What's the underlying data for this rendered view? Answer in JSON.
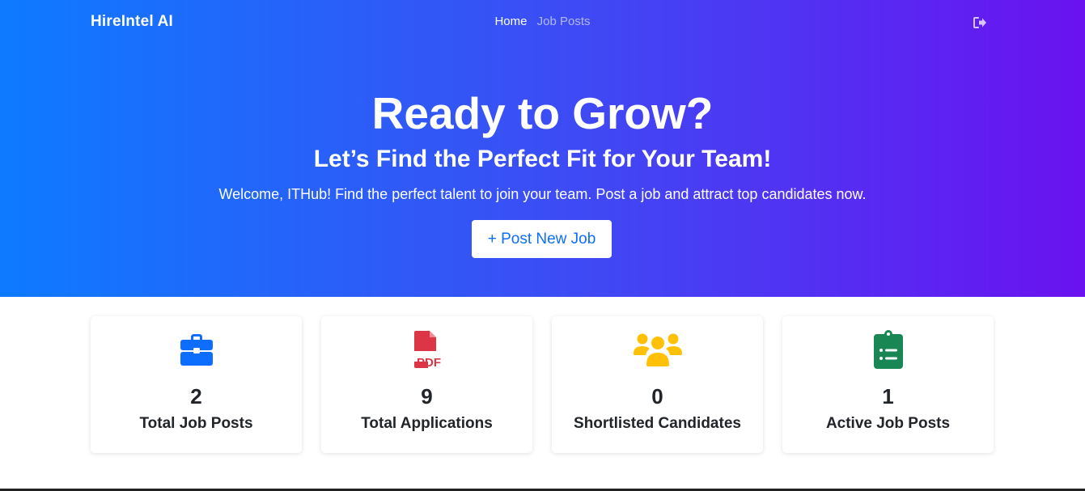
{
  "navbar": {
    "brand": "HireIntel AI",
    "links": [
      {
        "label": "Home"
      },
      {
        "label": "Job Posts"
      }
    ],
    "logout_icon": "sign-out-icon"
  },
  "hero": {
    "title": "Ready to Grow?",
    "subtitle": "Let’s Find the Perfect Fit for Your Team!",
    "welcome": "Welcome, ITHub! Find the perfect talent to join your team. Post a job and attract top candidates now.",
    "post_button": "+ Post New Job"
  },
  "stats": [
    {
      "value": "2",
      "label": "Total Job Posts",
      "icon": "briefcase-icon",
      "color": "#0d6efd"
    },
    {
      "value": "9",
      "label": "Total Applications",
      "icon": "pdf-file-icon",
      "color": "#dc3545"
    },
    {
      "value": "0",
      "label": "Shortlisted Candidates",
      "icon": "people-icon",
      "color": "#ffc107"
    },
    {
      "value": "1",
      "label": "Active Job Posts",
      "icon": "clipboard-list-icon",
      "color": "#198754"
    }
  ],
  "colors": {
    "gradient_start": "#0d7bff",
    "gradient_end": "#6a12f0",
    "primary": "#0d6efd"
  }
}
